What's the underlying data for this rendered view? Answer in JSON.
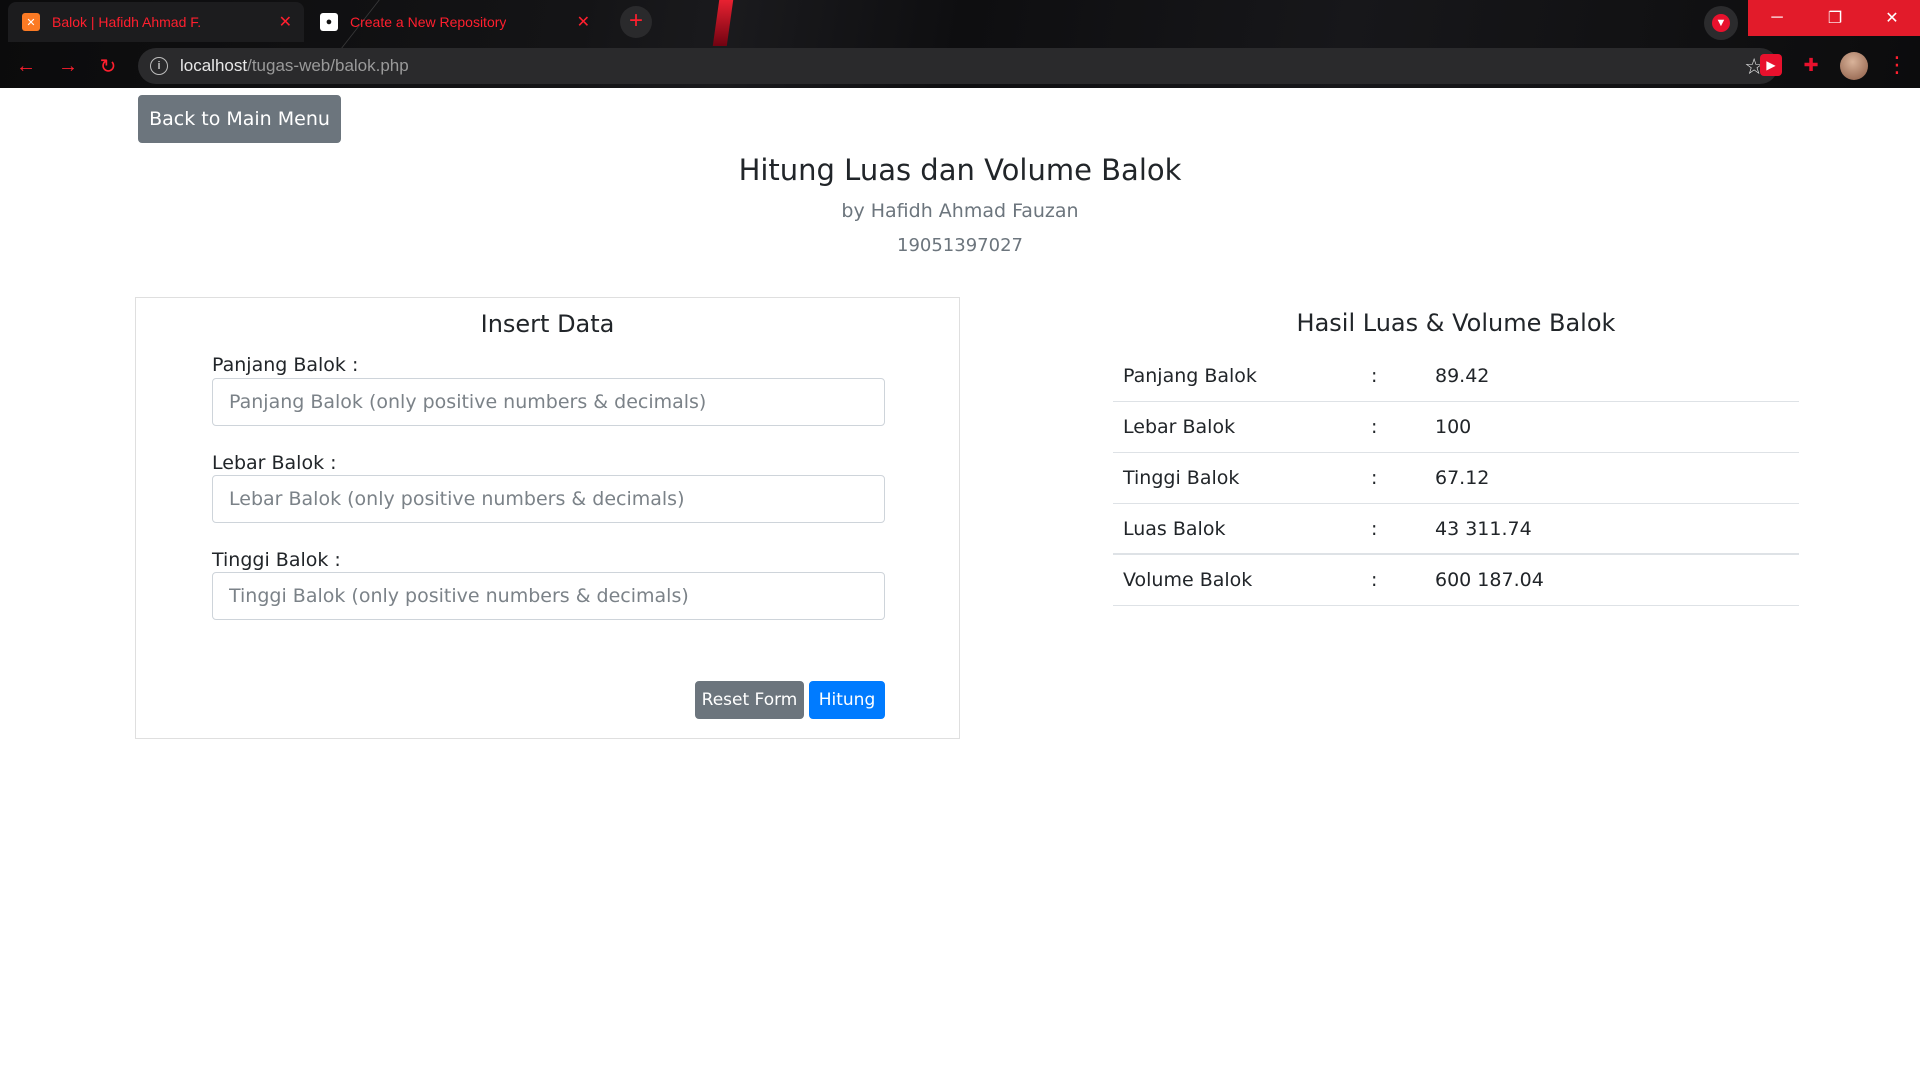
{
  "browser": {
    "tabs": [
      {
        "title": "Balok | Hafidh Ahmad F.",
        "icon": "xampp-icon"
      },
      {
        "title": "Create a New Repository",
        "icon": "github-icon"
      }
    ],
    "url_host": "localhost",
    "url_path": "/tugas-web/balok.php",
    "accent_color": "#ff1f2e"
  },
  "page": {
    "back_button": "Back to Main Menu",
    "title": "Hitung Luas dan Volume Balok",
    "author": "by Hafidh Ahmad Fauzan",
    "nim": "19051397027"
  },
  "form": {
    "title": "Insert Data",
    "fields": [
      {
        "label": "Panjang Balok :",
        "placeholder": "Panjang Balok (only positive numbers & decimals)",
        "value": ""
      },
      {
        "label": "Lebar Balok :",
        "placeholder": "Lebar Balok (only positive numbers & decimals)",
        "value": ""
      },
      {
        "label": "Tinggi Balok :",
        "placeholder": "Tinggi Balok (only positive numbers & decimals)",
        "value": ""
      }
    ],
    "reset_label": "Reset Form",
    "submit_label": "Hitung"
  },
  "result": {
    "title": "Hasil Luas & Volume Balok",
    "rows": [
      {
        "label": "Panjang Balok",
        "sep": ":",
        "value": "89.42"
      },
      {
        "label": "Lebar Balok",
        "sep": ":",
        "value": "100"
      },
      {
        "label": "Tinggi Balok",
        "sep": ":",
        "value": "67.12"
      },
      {
        "label": "Luas Balok",
        "sep": ":",
        "value": "43 311.74"
      },
      {
        "label": "Volume Balok",
        "sep": ":",
        "value": "600 187.04"
      }
    ]
  }
}
